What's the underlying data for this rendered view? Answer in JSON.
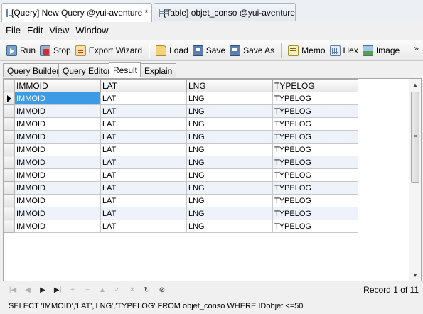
{
  "doc_tabs": [
    {
      "label": "[Query] New Query @yui-aventure *",
      "icon": "query-icon",
      "active": true
    },
    {
      "label": "[Table] objet_conso @yui-aventure",
      "icon": "table-icon",
      "active": false
    }
  ],
  "menu": [
    "File",
    "Edit",
    "View",
    "Window"
  ],
  "toolbar": {
    "run": "Run",
    "stop": "Stop",
    "export": "Export Wizard",
    "load": "Load",
    "save": "Save",
    "save_as": "Save As",
    "memo": "Memo",
    "hex": "Hex",
    "image": "Image",
    "more": "»"
  },
  "sub_tabs": [
    {
      "label": "Query Builder",
      "active": false
    },
    {
      "label": "Query Editor",
      "active": false
    },
    {
      "label": "Result",
      "active": true
    },
    {
      "label": "Explain",
      "active": false
    }
  ],
  "grid": {
    "columns": [
      "IMMOID",
      "LAT",
      "LNG",
      "TYPELOG"
    ],
    "rows": [
      [
        "IMMOID",
        "LAT",
        "LNG",
        "TYPELOG"
      ],
      [
        "IMMOID",
        "LAT",
        "LNG",
        "TYPELOG"
      ],
      [
        "IMMOID",
        "LAT",
        "LNG",
        "TYPELOG"
      ],
      [
        "IMMOID",
        "LAT",
        "LNG",
        "TYPELOG"
      ],
      [
        "IMMOID",
        "LAT",
        "LNG",
        "TYPELOG"
      ],
      [
        "IMMOID",
        "LAT",
        "LNG",
        "TYPELOG"
      ],
      [
        "IMMOID",
        "LAT",
        "LNG",
        "TYPELOG"
      ],
      [
        "IMMOID",
        "LAT",
        "LNG",
        "TYPELOG"
      ],
      [
        "IMMOID",
        "LAT",
        "LNG",
        "TYPELOG"
      ],
      [
        "IMMOID",
        "LAT",
        "LNG",
        "TYPELOG"
      ],
      [
        "IMMOID",
        "LAT",
        "LNG",
        "TYPELOG"
      ]
    ],
    "selected_row": 0,
    "selected_color": "#3b9be6",
    "alt_row_color": "#eef3fb"
  },
  "navigator": {
    "buttons": [
      {
        "name": "first-record-icon",
        "glyph": "|◀",
        "enabled": false
      },
      {
        "name": "prev-record-icon",
        "glyph": "◀",
        "enabled": false
      },
      {
        "name": "next-record-icon",
        "glyph": "▶",
        "enabled": true
      },
      {
        "name": "last-record-icon",
        "glyph": "▶|",
        "enabled": true
      },
      {
        "name": "insert-record-icon",
        "glyph": "+",
        "enabled": false
      },
      {
        "name": "delete-record-icon",
        "glyph": "−",
        "enabled": false
      },
      {
        "name": "edit-record-icon",
        "glyph": "▲",
        "enabled": false
      },
      {
        "name": "post-edit-icon",
        "glyph": "✓",
        "enabled": false
      },
      {
        "name": "cancel-edit-icon",
        "glyph": "✕",
        "enabled": false
      },
      {
        "name": "refresh-icon",
        "glyph": "↻",
        "enabled": true
      },
      {
        "name": "stop-icon",
        "glyph": "⊘",
        "enabled": true
      }
    ],
    "record_text": "Record 1 of 11"
  },
  "status": {
    "sql": "SELECT 'IMMOID','LAT','LNG','TYPELOG' FROM objet_conso WHERE IDobjet <=50"
  }
}
